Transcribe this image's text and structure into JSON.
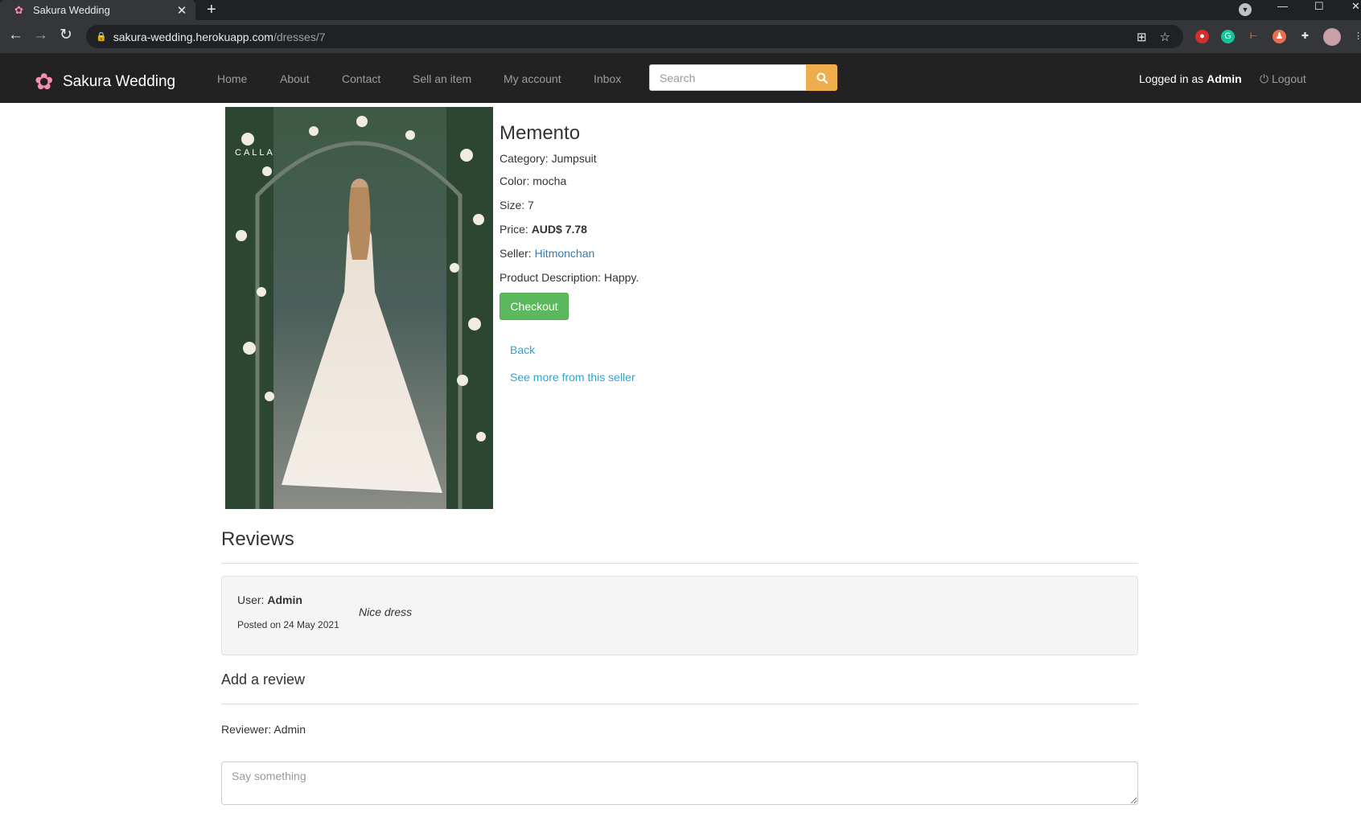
{
  "browser": {
    "tab_title": "Sakura Wedding",
    "url_host": "sakura-wedding.herokuapp.com",
    "url_path": "/dresses/7"
  },
  "navbar": {
    "brand": "Sakura Wedding",
    "items": [
      "Home",
      "About",
      "Contact",
      "Sell an item",
      "My account",
      "Inbox"
    ],
    "search_placeholder": "Search",
    "logged_in_prefix": "Logged in as ",
    "logged_in_user": "Admin",
    "logout": "Logout"
  },
  "product": {
    "name": "Memento",
    "category_label": "Category: ",
    "category": "Jumpsuit",
    "color_label": "Color: ",
    "color": "mocha",
    "size_label": "Size: ",
    "size": "7",
    "price_label": "Price: ",
    "price": "AUD$ 7.78",
    "seller_label": "Seller: ",
    "seller": "Hitmonchan",
    "description_label": "Product Description: ",
    "description": "Happy.",
    "checkout": "Checkout",
    "back": "Back",
    "see_more": "See more from this seller",
    "image_watermark": "CALLA"
  },
  "reviews": {
    "title": "Reviews",
    "items": [
      {
        "user_label": "User: ",
        "user": "Admin",
        "date": "Posted on 24 May 2021",
        "text": "Nice dress"
      }
    ]
  },
  "add_review": {
    "title": "Add a review",
    "reviewer": "Reviewer: Admin",
    "placeholder": "Say something"
  },
  "colors": {
    "navbar_bg": "#222222",
    "checkout_green": "#5cb85c",
    "search_orange": "#f0ad4e",
    "link_blue": "#2aa4d5"
  }
}
